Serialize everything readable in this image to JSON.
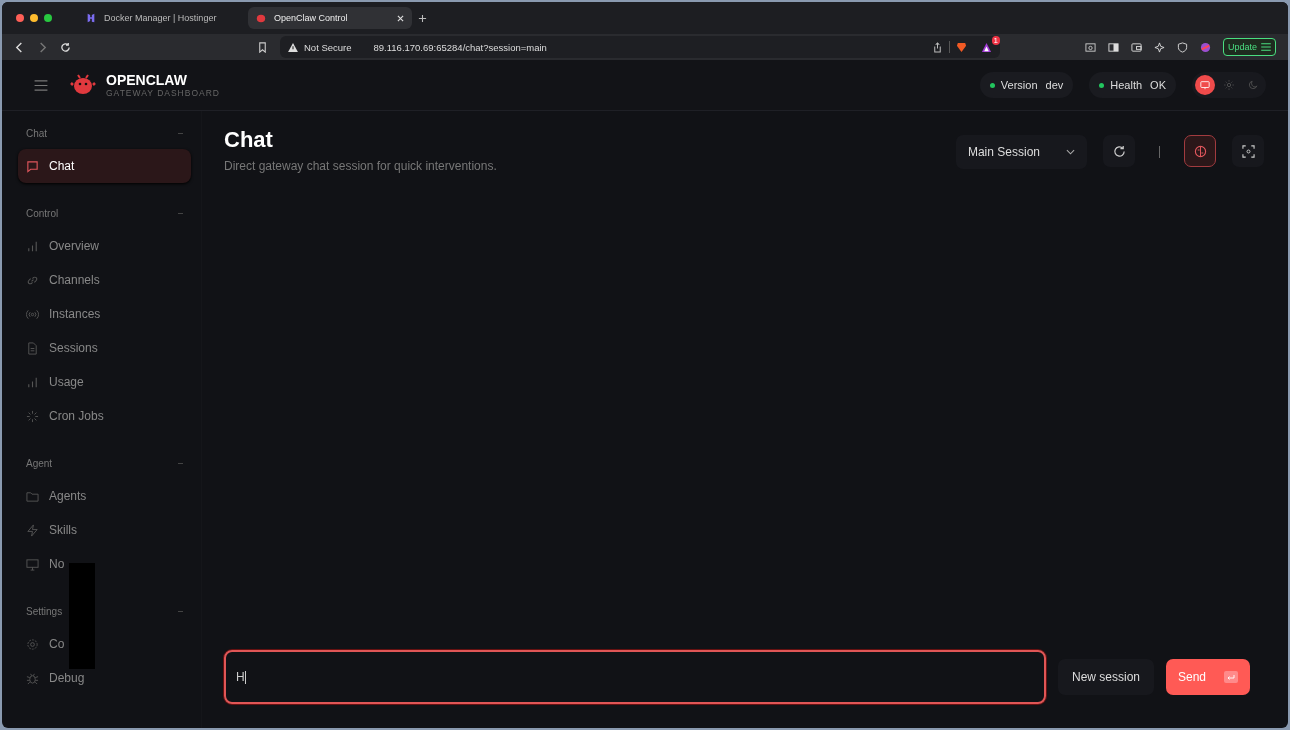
{
  "browser": {
    "tabs": [
      {
        "title": "Docker Manager | Hostinger",
        "selected": false
      },
      {
        "title": "OpenClaw Control",
        "selected": true
      }
    ],
    "security": "Not Secure",
    "url": "89.116.170.69:65284/chat?session=main",
    "notification_count": "1",
    "update_button": "Update"
  },
  "header": {
    "brand": "OPENCLAW",
    "subtitle": "GATEWAY DASHBOARD",
    "pills": [
      {
        "label": "Version",
        "value": "dev",
        "color": "#22c55e"
      },
      {
        "label": "Health",
        "value": "OK",
        "color": "#22c55e"
      }
    ],
    "theme": [
      {
        "kind": "system",
        "selected": true
      },
      {
        "kind": "light",
        "selected": false
      },
      {
        "kind": "dark",
        "selected": false
      }
    ]
  },
  "sidebar": {
    "groups": [
      {
        "title": "Chat",
        "items": [
          {
            "label": "Chat",
            "selected": true
          }
        ]
      },
      {
        "title": "Control",
        "items": [
          {
            "label": "Overview",
            "selected": false
          },
          {
            "label": "Channels",
            "selected": false
          },
          {
            "label": "Instances",
            "selected": false
          },
          {
            "label": "Sessions",
            "selected": false
          },
          {
            "label": "Usage",
            "selected": false
          },
          {
            "label": "Cron Jobs",
            "selected": false
          }
        ]
      },
      {
        "title": "Agent",
        "items": [
          {
            "label": "Agents",
            "selected": false
          },
          {
            "label": "Skills",
            "selected": false
          },
          {
            "label": "No",
            "selected": false
          }
        ]
      },
      {
        "title": "Settings",
        "items": [
          {
            "label": "Co",
            "selected": false
          },
          {
            "label": "Debug",
            "selected": false
          }
        ]
      }
    ]
  },
  "page": {
    "title": "Chat",
    "subtitle": "Direct gateway chat session for quick interventions.",
    "session_select": "Main Session",
    "thinking_toggle": {
      "on": true
    }
  },
  "composer": {
    "value": "H",
    "new_session": "New session",
    "send": "Send"
  }
}
